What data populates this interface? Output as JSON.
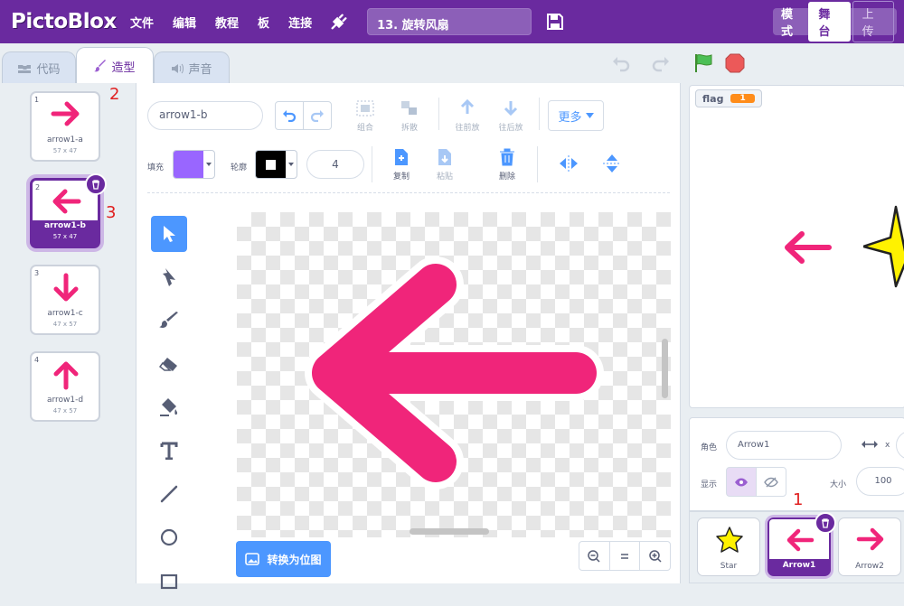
{
  "menubar": {
    "logo": "PictoBlox",
    "items": [
      "文件",
      "编辑",
      "教程",
      "板",
      "连接"
    ],
    "project_title": "13. 旋转风扇",
    "mode_label": "模式",
    "mode_stage": "舞台",
    "mode_upload": "上传"
  },
  "tabs": {
    "code": "代码",
    "costumes": "造型",
    "sounds": "声音"
  },
  "costumes": [
    {
      "num": "1",
      "name": "arrow1-a",
      "size": "57 x 47"
    },
    {
      "num": "2",
      "name": "arrow1-b",
      "size": "57 x 47"
    },
    {
      "num": "3",
      "name": "arrow1-c",
      "size": "47 x 57"
    },
    {
      "num": "4",
      "name": "arrow1-d",
      "size": "47 x 57"
    }
  ],
  "annotations": {
    "a1": "1",
    "a2": "2",
    "a3": "3"
  },
  "paint_editor": {
    "costume_name": "arrow1-b",
    "group": "组合",
    "ungroup": "拆散",
    "forward": "往前放",
    "backward": "往后放",
    "more": "更多",
    "fill_label": "填充",
    "outline_label": "轮廓",
    "outline_width": "4",
    "copy": "复制",
    "paste": "粘贴",
    "delete": "删除",
    "convert_bitmap": "转换为位图",
    "fill_color": "#9966ff",
    "outline_color": "#000000"
  },
  "stage": {
    "var_name": "flag",
    "var_value": "1"
  },
  "sprite_info": {
    "sprite_label": "角色",
    "sprite_name": "Arrow1",
    "x_label": "x",
    "show_label": "显示",
    "size_label": "大小",
    "size_value": "100"
  },
  "sprites": [
    {
      "name": "Star"
    },
    {
      "name": "Arrow1"
    },
    {
      "name": "Arrow2"
    }
  ],
  "colors": {
    "brand": "#6a2a9f",
    "accent": "#4c97ff",
    "arrow": "#f0257a"
  }
}
